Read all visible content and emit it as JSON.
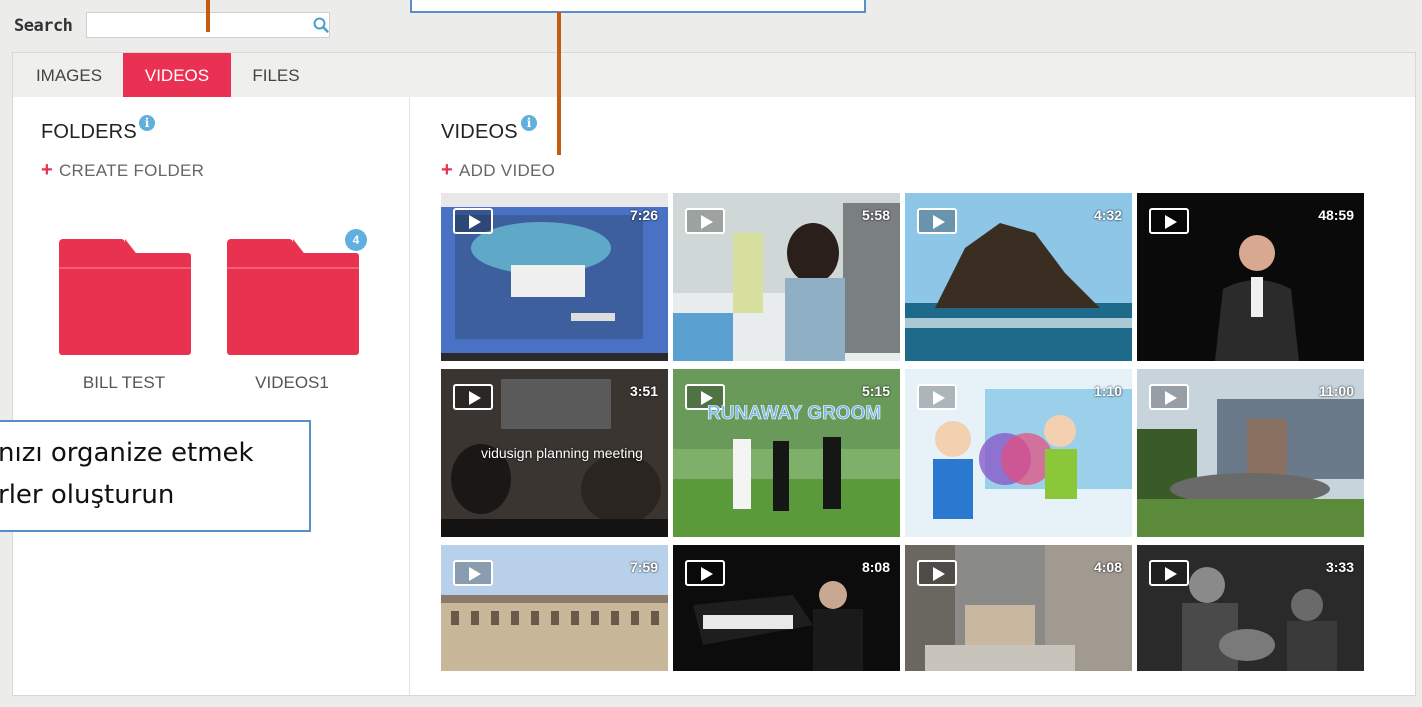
{
  "search": {
    "label": "Search",
    "value": ""
  },
  "tabs": [
    {
      "label": "IMAGES",
      "active": false
    },
    {
      "label": "VIDEOS",
      "active": true
    },
    {
      "label": "FILES",
      "active": false
    }
  ],
  "folders_panel": {
    "title": "FOLDERS",
    "info_icon": "i",
    "create_label": "CREATE FOLDER",
    "folders": [
      {
        "name": "BILL TEST",
        "badge": null
      },
      {
        "name": "VIDEOS1",
        "badge": "4"
      }
    ]
  },
  "videos_panel": {
    "title": "VIDEOS",
    "info_icon": "i",
    "add_label": "ADD VIDEO",
    "videos": [
      {
        "duration": "7:26",
        "icon": "screen-recording"
      },
      {
        "duration": "5:58",
        "icon": "classroom-people"
      },
      {
        "duration": "4:32",
        "icon": "sea-rock"
      },
      {
        "duration": "48:59",
        "icon": "speaker-on-stage"
      },
      {
        "duration": "3:51",
        "icon": "meeting",
        "caption": "vidusign planning meeting"
      },
      {
        "duration": "5:15",
        "icon": "runaway-groom",
        "caption": "RUNAWAY GROOM"
      },
      {
        "duration": "1:10",
        "icon": "cartoon"
      },
      {
        "duration": "11:00",
        "icon": "fountain"
      },
      {
        "duration": "7:59",
        "icon": "palace"
      },
      {
        "duration": "8:08",
        "icon": "pianist"
      },
      {
        "duration": "4:08",
        "icon": "street"
      },
      {
        "duration": "3:33",
        "icon": "guitarist"
      }
    ]
  },
  "callout": {
    "line1": "nızı organize etmek",
    "line2": "rler oluşturun"
  },
  "colors": {
    "accent": "#ea3153",
    "info": "#5fb0dc",
    "callout_border": "#5b8ec9",
    "pointer": "#c55a11"
  }
}
